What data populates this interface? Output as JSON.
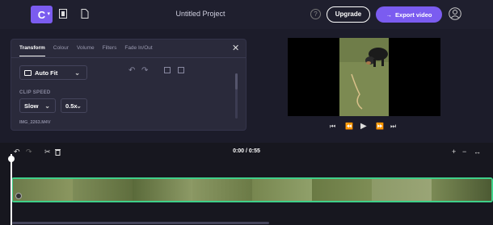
{
  "app": {
    "logo_letter": "C",
    "project_title": "Untitled Project",
    "help_label": "?",
    "upgrade_label": "Upgrade",
    "export_label": "Export video"
  },
  "panel": {
    "tabs": [
      "Transform",
      "Colour",
      "Volume",
      "Filters",
      "Fade In/Out"
    ],
    "active_tab": "Transform",
    "fit_value": "Auto Fit",
    "clip_speed_label": "CLIP SPEED",
    "speed_value": "Slow",
    "speed_multiplier": "0.5x",
    "file_name": "IMG_2263.M4V"
  },
  "timeline": {
    "time_display": "0:00 / 0:55",
    "zoom_in": "+",
    "zoom_out": "−",
    "fit_label": "↔"
  },
  "icons": {
    "close": "✕",
    "chevron": "⌄",
    "rotate_left": "↶",
    "rotate_right": "↷",
    "undo": "↶",
    "redo": "↷",
    "split": "✂",
    "delete": "🗑",
    "skip_back": "⏮",
    "rewind": "⏪",
    "play": "▶",
    "forward": "⏩",
    "skip_forward": "⏭"
  },
  "colors": {
    "accent": "#7b5cf0",
    "clip_border": "#3fd08a",
    "background": "#1c1c2a"
  }
}
